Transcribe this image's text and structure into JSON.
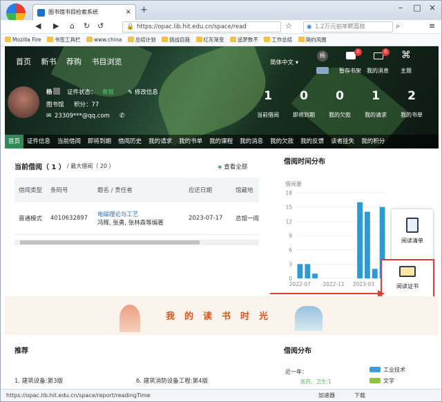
{
  "browser": {
    "tab_title": "图书馆书目检索系统",
    "new_tab": "+",
    "url": "https://opac.lib.hit.edu.cn/space/read",
    "search_text": "1.2万元拍单颗荔枝",
    "bookmarks": [
      "Mozilla Fire",
      "书签工具栏",
      "www.china",
      "总结计划",
      "挑战自我",
      "红灰渐变",
      "追梦数不",
      "工作总结",
      "简约风图"
    ],
    "status_url": "https://opac.lib.hit.edu.cn/space/report/readingTime",
    "status_right": [
      "加速器",
      "下载"
    ]
  },
  "topnav": {
    "items": [
      "首页",
      "新书",
      "荐购",
      "书目浏览"
    ],
    "language": "简体中文",
    "avatar_char": "杨",
    "icons": [
      {
        "label": "暂存书架",
        "badge": "0"
      },
      {
        "label": "我的消息",
        "badge": "0"
      },
      {
        "label": "主题",
        "badge": ""
      }
    ]
  },
  "user": {
    "name": "杨",
    "cert_label": "证件状态：",
    "cert_status": "有效",
    "edit_label": "修改信息",
    "library": "图书馆",
    "points": "积分：77",
    "email": "23309***@qq.com"
  },
  "stats": [
    {
      "value": "1",
      "label": "当前借阅"
    },
    {
      "value": "0",
      "label": "即将到期"
    },
    {
      "value": "0",
      "label": "我的欠款"
    },
    {
      "value": "1",
      "label": "我的请求"
    },
    {
      "value": "2",
      "label": "我的书单"
    }
  ],
  "tabs": [
    "首页",
    "证件信息",
    "当前借阅",
    "即将到期",
    "借阅历史",
    "我的请求",
    "我的书单",
    "我的课程",
    "我的消息",
    "我的欠款",
    "我的反馈",
    "读者挂失",
    "我的积分"
  ],
  "current_loans": {
    "title": "当前借阅（ 1 ）",
    "max_label": "/ 最大借阅（ 20 ）",
    "view_all": "查看全部",
    "columns": [
      "借阅类型",
      "条码号",
      "题名 / 责任者",
      "应还日期",
      "馆藏地"
    ],
    "rows": [
      {
        "type": "普通模式",
        "barcode": "4010632897",
        "title": "电磁理论与工艺",
        "author": "冯辉, 张勇, 张林森等编著",
        "due": "2023-07-17",
        "location": "总馆一阅室(三"
      }
    ]
  },
  "loan_chart": {
    "title": "借阅时间分布"
  },
  "chart_data": {
    "type": "bar",
    "title": "",
    "ylabel": "借阅量",
    "xlabel": "",
    "ylim": [
      0,
      18
    ],
    "yticks": [
      0,
      3,
      6,
      9,
      12,
      15,
      18
    ],
    "xtick_labels": [
      "2022-07",
      "2022-11",
      "2023-03"
    ],
    "values": [
      3,
      3,
      1,
      0,
      0,
      0,
      0,
      0,
      16,
      14,
      2,
      15
    ]
  },
  "side_popup": {
    "items": [
      "阅读清单",
      "阅读证书"
    ]
  },
  "banner": {
    "text": "我的读书时光"
  },
  "recommend": {
    "title": "推荐",
    "items": [
      "1. 建筑设备:第3版",
      "6. 建筑消防设备工程:第4版"
    ]
  },
  "distribution": {
    "title": "借阅分布",
    "near_year": "近一年：",
    "annotation": "医药、卫生:1",
    "legend": [
      {
        "label": "工业技术",
        "color": "#3d9be0"
      },
      {
        "label": "文学",
        "color": "#8cc63f"
      }
    ]
  }
}
